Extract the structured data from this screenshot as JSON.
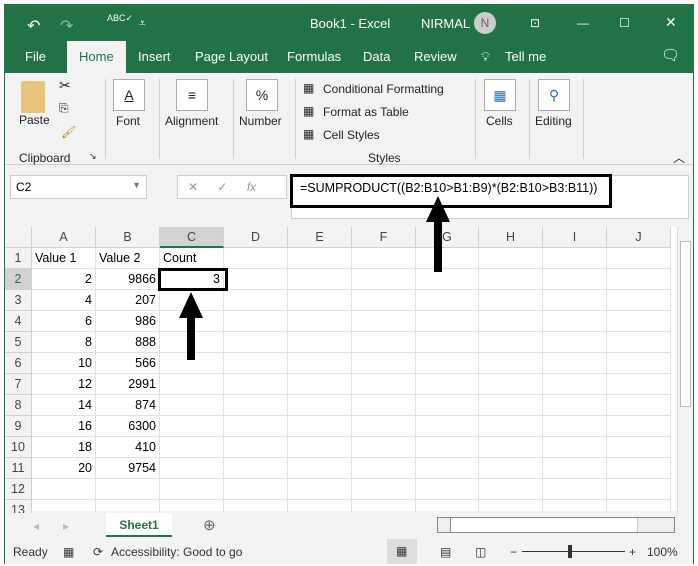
{
  "title": {
    "doc": "Book1  -  Excel",
    "user": "NIRMAL",
    "avatar": "N"
  },
  "tabs": [
    "File",
    "Home",
    "Insert",
    "Page Layout",
    "Formulas",
    "Data",
    "Review",
    "Tell me"
  ],
  "ribbon": {
    "paste": "Paste",
    "clipboard": "Clipboard",
    "font": "Font",
    "alignment": "Alignment",
    "number": "Number",
    "conditional": "Conditional Formatting",
    "format_table": "Format as Table",
    "cell_styles": "Cell Styles",
    "styles": "Styles",
    "cells": "Cells",
    "editing": "Editing"
  },
  "formula_bar": {
    "name_box": "C2",
    "formula": "=SUMPRODUCT((B2:B10>B1:B9)*(B2:B10>B3:B11))"
  },
  "columns": [
    "A",
    "B",
    "C",
    "D",
    "E",
    "F",
    "G",
    "H",
    "I",
    "J"
  ],
  "rows": [
    [
      "Value 1",
      "Value 2",
      "Count"
    ],
    [
      "2",
      "9866",
      "3"
    ],
    [
      "4",
      "207",
      ""
    ],
    [
      "6",
      "986",
      ""
    ],
    [
      "8",
      "888",
      ""
    ],
    [
      "10",
      "566",
      ""
    ],
    [
      "12",
      "2991",
      ""
    ],
    [
      "14",
      "874",
      ""
    ],
    [
      "16",
      "6300",
      ""
    ],
    [
      "18",
      "410",
      ""
    ],
    [
      "20",
      "9754",
      ""
    ],
    [
      "",
      "",
      ""
    ],
    [
      "",
      "",
      ""
    ]
  ],
  "sheet_tab": "Sheet1",
  "status": {
    "ready": "Ready",
    "accessibility": "Accessibility: Good to go",
    "zoom": "100%"
  },
  "colors": {
    "accent": "#217346"
  }
}
